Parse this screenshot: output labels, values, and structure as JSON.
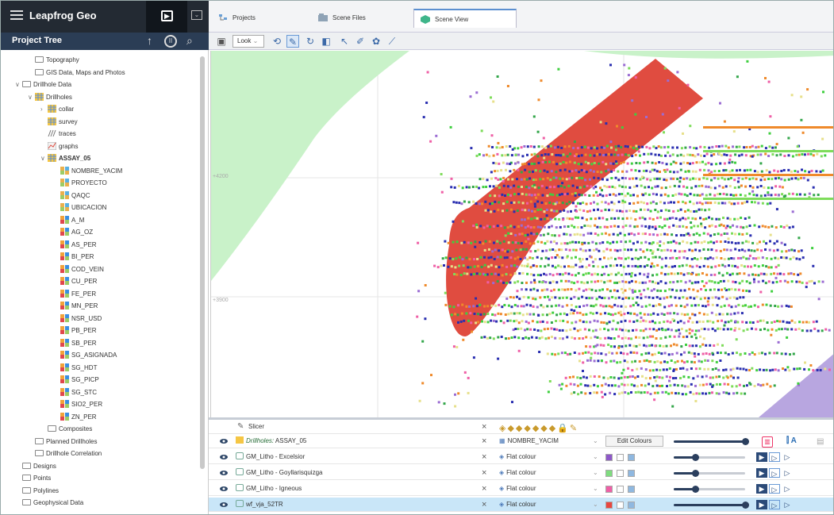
{
  "app": {
    "title": "Leapfrog Geo"
  },
  "project_tree": {
    "title": "Project Tree",
    "items": [
      {
        "label": "Topography",
        "level": 1,
        "icon": "folder-icon"
      },
      {
        "label": "GIS Data, Maps and Photos",
        "level": 1,
        "icon": "folder-icon"
      },
      {
        "label": "Drillhole Data",
        "level": 0,
        "icon": "folder-icon",
        "expanded": true
      },
      {
        "label": "Drillholes",
        "level": 1,
        "icon": "drillholes-icon",
        "expanded": true
      },
      {
        "label": "collar",
        "level": 2,
        "icon": "table-icon",
        "collapsed": true
      },
      {
        "label": "survey",
        "level": 2,
        "icon": "table-icon"
      },
      {
        "label": "traces",
        "level": 2,
        "icon": "traces-icon"
      },
      {
        "label": "graphs",
        "level": 2,
        "icon": "graphs-icon"
      },
      {
        "label": "ASSAY_05",
        "level": 2,
        "icon": "table-icon",
        "expanded": true,
        "bold": true
      },
      {
        "label": "NOMBRE_YACIM",
        "level": 3,
        "icon": "category-column-icon"
      },
      {
        "label": "PROYECTO",
        "level": 3,
        "icon": "category-column-icon"
      },
      {
        "label": "QAQC",
        "level": 3,
        "icon": "category-column-icon"
      },
      {
        "label": "UBICACION",
        "level": 3,
        "icon": "category-column-icon"
      },
      {
        "label": "A_M",
        "level": 3,
        "icon": "numeric-column-icon"
      },
      {
        "label": "AG_OZ",
        "level": 3,
        "icon": "numeric-column-icon"
      },
      {
        "label": "AS_PER",
        "level": 3,
        "icon": "numeric-column-icon"
      },
      {
        "label": "BI_PER",
        "level": 3,
        "icon": "numeric-column-icon"
      },
      {
        "label": "COD_VEIN",
        "level": 3,
        "icon": "numeric-column-icon"
      },
      {
        "label": "CU_PER",
        "level": 3,
        "icon": "numeric-column-icon"
      },
      {
        "label": "FE_PER",
        "level": 3,
        "icon": "numeric-column-icon"
      },
      {
        "label": "MN_PER",
        "level": 3,
        "icon": "numeric-column-icon"
      },
      {
        "label": "NSR_USD",
        "level": 3,
        "icon": "numeric-column-icon"
      },
      {
        "label": "PB_PER",
        "level": 3,
        "icon": "numeric-column-icon"
      },
      {
        "label": "SB_PER",
        "level": 3,
        "icon": "numeric-column-icon"
      },
      {
        "label": "SG_ASIGNADA",
        "level": 3,
        "icon": "numeric-column-icon"
      },
      {
        "label": "SG_HDT",
        "level": 3,
        "icon": "numeric-column-icon"
      },
      {
        "label": "SG_PICP",
        "level": 3,
        "icon": "numeric-column-icon"
      },
      {
        "label": "SG_STC",
        "level": 3,
        "icon": "numeric-column-icon"
      },
      {
        "label": "SIO2_PER",
        "level": 3,
        "icon": "numeric-column-icon"
      },
      {
        "label": "ZN_PER",
        "level": 3,
        "icon": "numeric-column-icon"
      },
      {
        "label": "Composites",
        "level": 2,
        "icon": "folder-icon"
      },
      {
        "label": "Planned Drillholes",
        "level": 1,
        "icon": "folder-icon"
      },
      {
        "label": "Drillhole Correlation",
        "level": 1,
        "icon": "folder-icon"
      },
      {
        "label": "Designs",
        "level": 0,
        "icon": "folder-icon"
      },
      {
        "label": "Points",
        "level": 0,
        "icon": "folder-icon"
      },
      {
        "label": "Polylines",
        "level": 0,
        "icon": "folder-icon"
      },
      {
        "label": "Geophysical Data",
        "level": 0,
        "icon": "folder-icon"
      }
    ]
  },
  "tabs": [
    {
      "label": "Projects",
      "icon": "projects-icon"
    },
    {
      "label": "Scene Files",
      "icon": "scene-files-icon"
    },
    {
      "label": "Scene View",
      "icon": "scene-view-icon",
      "active": true
    }
  ],
  "toolbar": {
    "look_label": "Look"
  },
  "scene": {
    "grid_labels": [
      "+4200",
      "+3900"
    ]
  },
  "layers": {
    "slicer_label": "Slicer",
    "edit_colours_label": "Edit Colours",
    "rows": [
      {
        "prefix": "Drillholes:",
        "name": "ASSAY_05",
        "property": "NOMBRE_YACIM",
        "prop_icon": "category-column-icon",
        "transparency": 1.0,
        "selected": false
      },
      {
        "prefix": "",
        "name": "GM_Litho - Excelsior",
        "property": "Flat colour",
        "prop_icon": "paint-bucket-icon",
        "colour": "#8e58c9",
        "transparency": 0.3,
        "selected": false
      },
      {
        "prefix": "",
        "name": "GM_Litho - Goyllarisquizga",
        "property": "Flat colour",
        "prop_icon": "paint-bucket-icon",
        "colour": "#7fdc7f",
        "transparency": 0.3,
        "selected": false
      },
      {
        "prefix": "",
        "name": "GM_Litho - Igneous",
        "property": "Flat colour",
        "prop_icon": "paint-bucket-icon",
        "colour": "#ef5fa6",
        "transparency": 0.3,
        "selected": false
      },
      {
        "prefix": "",
        "name": "wf_vja_52TR",
        "property": "Flat colour",
        "prop_icon": "paint-bucket-icon",
        "colour": "#e8473f",
        "transparency": 1.0,
        "selected": true
      }
    ]
  }
}
